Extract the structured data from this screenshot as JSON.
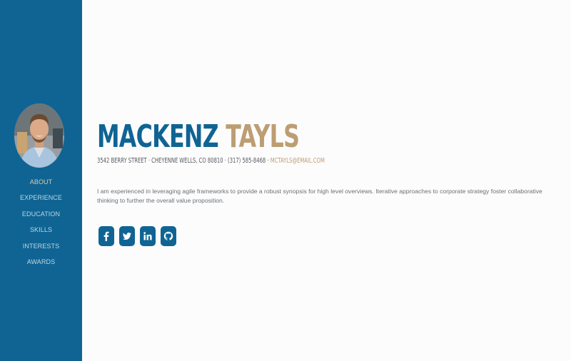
{
  "profile": {
    "first_name": "MACKENZ",
    "last_name": "TAYLS",
    "address": "3542 BERRY STREET · CHEYENNE WELLS, CO 80810 · (317) 585-8468 · ",
    "email": "MCTAYLS@EMAIL.COM",
    "bio": "I am experienced in leveraging agile frameworks to provide a robust synopsis for high level overviews. Iterative approaches to corporate strategy foster collaborative thinking to further the overall value proposition."
  },
  "nav": {
    "items": [
      {
        "label": "ABOUT",
        "active": true
      },
      {
        "label": "EXPERIENCE"
      },
      {
        "label": "EDUCATION"
      },
      {
        "label": "SKILLS"
      },
      {
        "label": "INTERESTS"
      },
      {
        "label": "AWARDS"
      }
    ]
  },
  "social": [
    "facebook-icon",
    "twitter-icon",
    "linkedin-icon",
    "github-icon"
  ],
  "colors": {
    "sidebar": "#0f6494",
    "accent": "#bd9d72",
    "nav_active": "#e6c69a",
    "background": "#fcfcfd"
  }
}
